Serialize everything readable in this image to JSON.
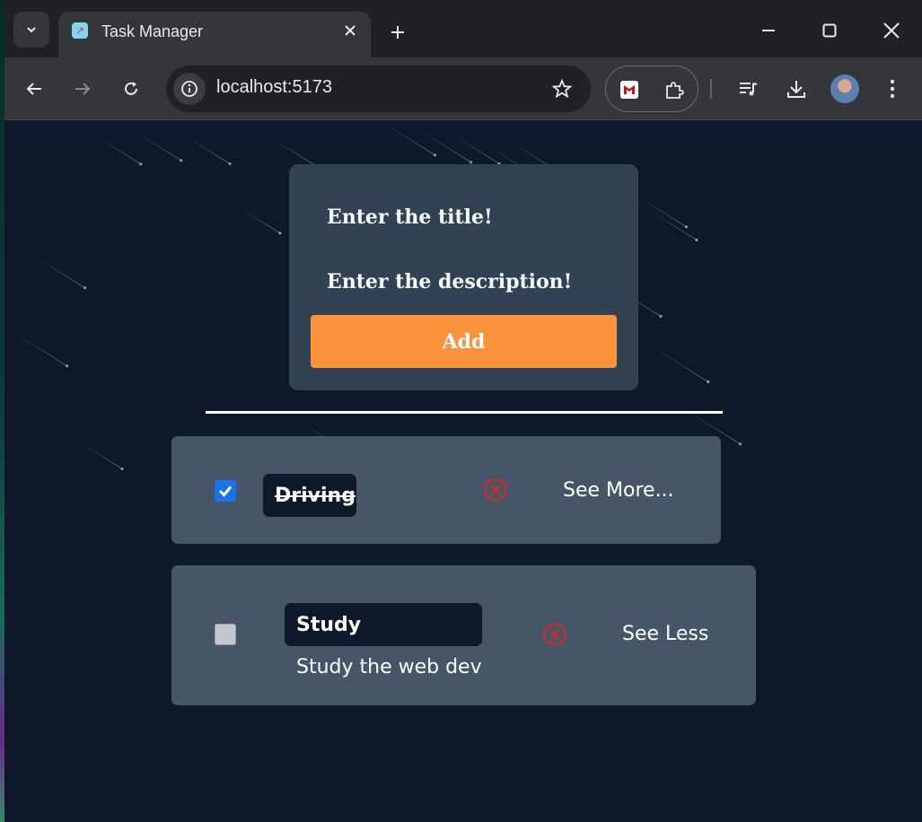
{
  "browser": {
    "tab_title": "Task Manager",
    "url": "localhost:5173"
  },
  "icons": {
    "tab_list": "chevron-down-icon",
    "favicon": "rocket-icon",
    "tab_close": "close-icon",
    "new_tab": "plus-icon",
    "minimize": "minimize-icon",
    "maximize": "maximize-icon",
    "close_window": "close-icon",
    "back": "arrow-left-icon",
    "forward": "arrow-right-icon",
    "reload": "reload-icon",
    "site_info": "info-icon",
    "bookmark": "star-icon",
    "extension_1": "mcafee-icon",
    "extensions": "puzzle-icon",
    "reading_list": "playlist-icon",
    "downloads": "download-icon",
    "menu": "kebab-menu-icon",
    "delete": "circle-x-icon"
  },
  "form": {
    "title_placeholder": "Enter the title!",
    "description_placeholder": "Enter the description!",
    "add_label": "Add"
  },
  "todos": [
    {
      "title": "Driving",
      "completed": true,
      "toggle_label": "See More...",
      "description": ""
    },
    {
      "title": "Study",
      "completed": false,
      "toggle_label": "See Less",
      "description": "Study the web dev"
    }
  ],
  "colors": {
    "page_bg": "#0f172a",
    "card_bg": "#334155",
    "todo_bg": "#475569",
    "accent": "#fb923c",
    "delete_red": "#dc2626",
    "checkbox_blue": "#1a73e8"
  }
}
